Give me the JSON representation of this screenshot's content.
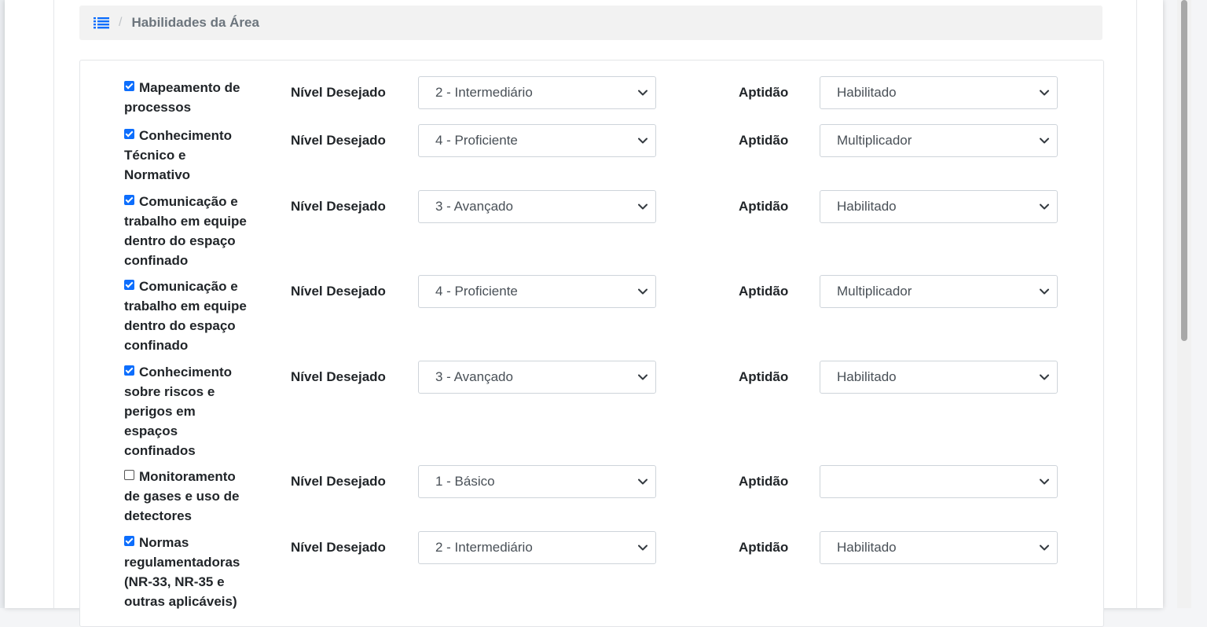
{
  "breadcrumb": {
    "current": "Habilidades da Área",
    "separator": "/"
  },
  "labels": {
    "nivel": "Nível Desejado",
    "aptidao": "Aptidão"
  },
  "rows": [
    {
      "checked": true,
      "lines": [
        "Mapeamento de",
        "processos"
      ],
      "nivel": "2 - Intermediário",
      "aptidao": "Habilitado"
    },
    {
      "checked": true,
      "lines": [
        "Conhecimento",
        "Técnico e",
        "Normativo"
      ],
      "nivel": "4 - Proficiente",
      "aptidao": "Multiplicador"
    },
    {
      "checked": true,
      "lines": [
        "Comunicação e",
        "trabalho em equipe",
        "dentro do espaço",
        "confinado"
      ],
      "nivel": "3 - Avançado",
      "aptidao": "Habilitado"
    },
    {
      "checked": true,
      "lines": [
        "Comunicação e",
        "trabalho em equipe",
        "dentro do espaço",
        "confinado"
      ],
      "nivel": "4 - Proficiente",
      "aptidao": "Multiplicador"
    },
    {
      "checked": true,
      "lines": [
        "Conhecimento",
        "sobre riscos e",
        "perigos em",
        "espaços",
        "confinados"
      ],
      "nivel": "3 - Avançado",
      "aptidao": "Habilitado"
    },
    {
      "checked": false,
      "lines": [
        "Monitoramento",
        "de gases e uso de",
        "detectores"
      ],
      "nivel": "1 - Básico",
      "aptidao": ""
    },
    {
      "checked": true,
      "lines": [
        "Normas",
        "regulamentadoras",
        "(NR-33, NR-35 e",
        "outras aplicáveis)"
      ],
      "nivel": "2 - Intermediário",
      "aptidao": "Habilitado"
    }
  ]
}
